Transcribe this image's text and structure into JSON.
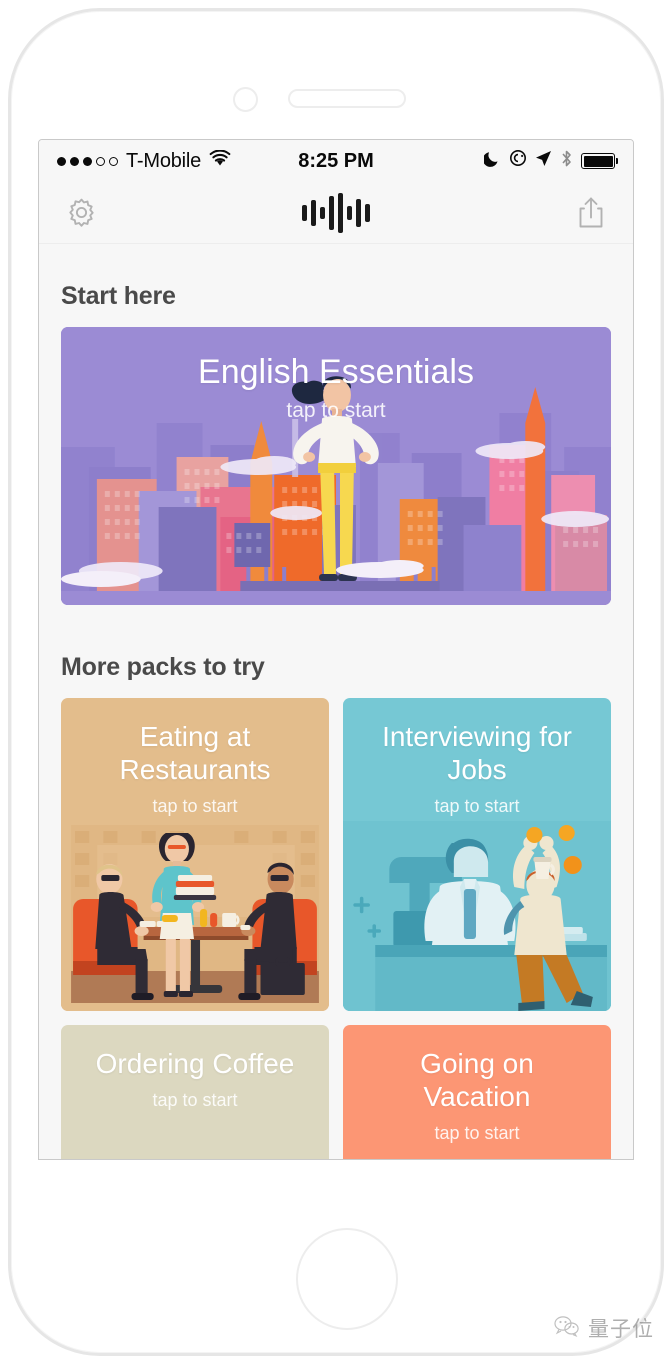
{
  "status_bar": {
    "signal_dots_filled": 3,
    "signal_dots_total": 5,
    "carrier": "T-Mobile",
    "wifi_icon": "wifi-icon",
    "time": "8:25 PM",
    "moon_icon": "do-not-disturb-moon-icon",
    "lock_rotation_icon": "rotation-lock-icon",
    "location_icon": "location-arrow-icon",
    "bluetooth_icon": "bluetooth-icon",
    "battery_icon": "battery-full-icon",
    "battery_level": 100
  },
  "nav_bar": {
    "settings_icon": "gear-icon",
    "logo_icon": "audio-waveform-logo",
    "share_icon": "share-icon"
  },
  "main": {
    "start_section": {
      "heading": "Start here",
      "card": {
        "title": "English Essentials",
        "subtitle": "tap to start",
        "color": "#9b8bd4",
        "illustration": "city-skyline-woman"
      }
    },
    "more_section": {
      "heading": "More packs to try",
      "cards": [
        {
          "title_line1": "Eating at",
          "title_line2": "Restaurants",
          "subtitle": "tap to start",
          "color": "#e3bd8c",
          "illustration": "restaurant-diner-scene"
        },
        {
          "title_line1": "Interviewing for",
          "title_line2": "Jobs",
          "subtitle": "tap to start",
          "color": "#76c8d4",
          "illustration": "job-interview-scene"
        },
        {
          "title_line1": "Ordering Coffee",
          "title_line2": "",
          "subtitle": "tap to start",
          "color": "#dcd8c0",
          "illustration": "coffee-shop-scene"
        },
        {
          "title_line1": "Going on",
          "title_line2": "Vacation",
          "subtitle": "tap to start",
          "color": "#fc9674",
          "illustration": "vacation-sunset-scene"
        }
      ]
    }
  },
  "watermark": {
    "icon": "wechat-logo-icon",
    "text": "量子位"
  }
}
